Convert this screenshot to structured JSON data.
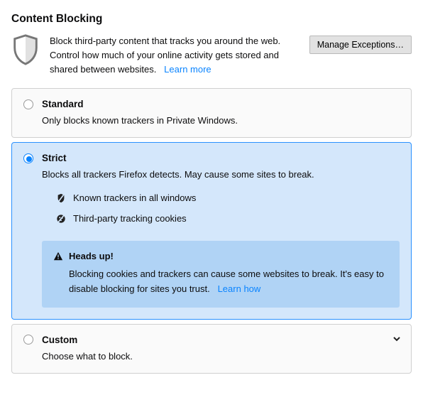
{
  "title": "Content Blocking",
  "intro_text_a": "Block third-party content that tracks you around the web. Control how much of your online activity gets stored and shared between websites.",
  "learn_more": "Learn more",
  "manage_exceptions": "Manage Exceptions…",
  "options": {
    "standard": {
      "title": "Standard",
      "desc": "Only blocks known trackers in Private Windows."
    },
    "strict": {
      "title": "Strict",
      "desc": "Blocks all trackers Firefox detects. May cause some sites to break.",
      "feature_trackers": "Known trackers in all windows",
      "feature_cookies": "Third-party tracking cookies",
      "heads_up_title": "Heads up!",
      "heads_up_body": "Blocking cookies and trackers can cause some websites to break. It's easy to disable blocking for sites you trust.",
      "learn_how": "Learn how"
    },
    "custom": {
      "title": "Custom",
      "desc": "Choose what to block."
    }
  }
}
